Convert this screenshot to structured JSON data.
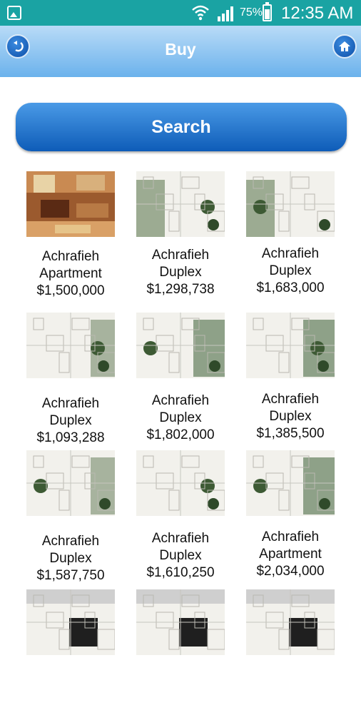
{
  "status_bar": {
    "battery_percent": "75%",
    "time": "12:35 AM",
    "icons": [
      "image-icon",
      "wifi-icon",
      "signal-icon",
      "battery-icon"
    ]
  },
  "header": {
    "title": "Buy",
    "back_icon": "back-arrow-icon",
    "home_icon": "home-icon"
  },
  "search": {
    "label": "Search"
  },
  "listings": [
    {
      "area": "Achrafieh",
      "type": "Apartment",
      "price": "$1,500,000",
      "image": "photo"
    },
    {
      "area": "Achrafieh",
      "type": "Duplex",
      "price": "$1,298,738",
      "image": "floorplan"
    },
    {
      "area": "Achrafieh",
      "type": "Duplex",
      "price": "$1,683,000",
      "image": "floorplan"
    },
    {
      "area": "Achrafieh",
      "type": "Duplex",
      "price": "$1,093,288",
      "image": "floorplan"
    },
    {
      "area": "Achrafieh",
      "type": "Duplex",
      "price": "$1,802,000",
      "image": "floorplan"
    },
    {
      "area": "Achrafieh",
      "type": "Duplex",
      "price": "$1,385,500",
      "image": "floorplan"
    },
    {
      "area": "Achrafieh",
      "type": "Duplex",
      "price": "$1,587,750",
      "image": "floorplan"
    },
    {
      "area": "Achrafieh",
      "type": "Duplex",
      "price": "$1,610,250",
      "image": "floorplan"
    },
    {
      "area": "Achrafieh",
      "type": "Apartment",
      "price": "$2,034,000",
      "image": "floorplan"
    },
    {
      "area": "",
      "type": "",
      "price": "",
      "image": "floorplan"
    },
    {
      "area": "",
      "type": "",
      "price": "",
      "image": "floorplan"
    },
    {
      "area": "",
      "type": "",
      "price": "",
      "image": "floorplan"
    }
  ],
  "colors": {
    "status_bar": "#1aa3a3",
    "header_top": "#b9dbf7",
    "header_bottom": "#6bb2ec",
    "button_blue": "#0e5cb8"
  }
}
